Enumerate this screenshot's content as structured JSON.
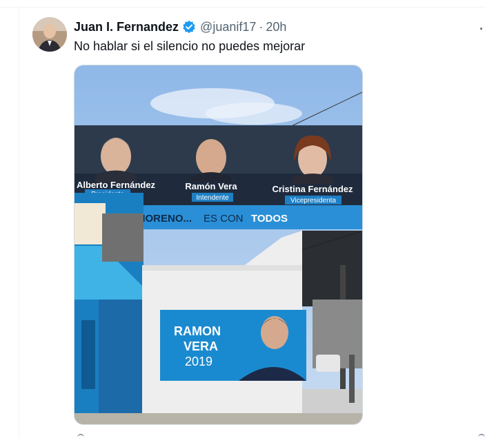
{
  "tweet": {
    "author_name": "Juan I. Fernandez",
    "handle": "@juanif17",
    "separator": "·",
    "time": "20h",
    "text": "No hablar si el silencio no puedes mejorar",
    "more_icon": "more-icon"
  },
  "media": {
    "banner": {
      "person1_name": "Alberto Fernández",
      "person1_role": "Presidente",
      "person2_name": "Ramón Vera",
      "person2_role": "Intendente",
      "person3_name": "Cristina Fernández",
      "person3_role": "Vicepresidenta",
      "slogan_a": "EN MORENO...",
      "slogan_b": "ES CON",
      "slogan_c": "TODOS"
    },
    "poster": {
      "line1": "RAMON",
      "line2": "VERA",
      "line3": "2019"
    }
  }
}
